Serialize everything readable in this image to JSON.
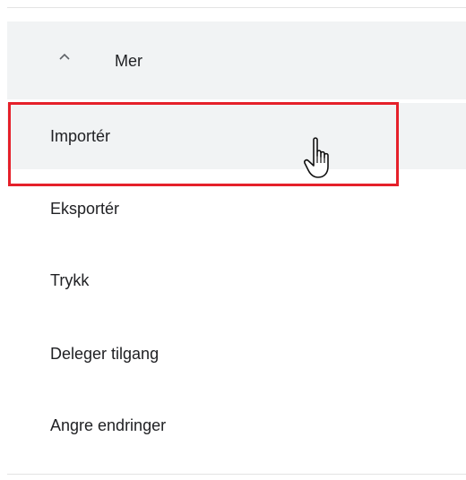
{
  "menu": {
    "header": {
      "label": "Mer",
      "icon": "chevron-up-icon"
    },
    "items": [
      {
        "label": "Importér"
      },
      {
        "label": "Eksportér"
      },
      {
        "label": "Trykk"
      },
      {
        "label": "Deleger tilgang"
      },
      {
        "label": "Angre endringer"
      }
    ]
  },
  "colors": {
    "hover_background": "#f1f3f4",
    "highlight_border": "#e5202a",
    "divider": "#e3e3e3",
    "text": "#202124"
  },
  "cursor": {
    "icon": "hand-pointer-icon"
  }
}
